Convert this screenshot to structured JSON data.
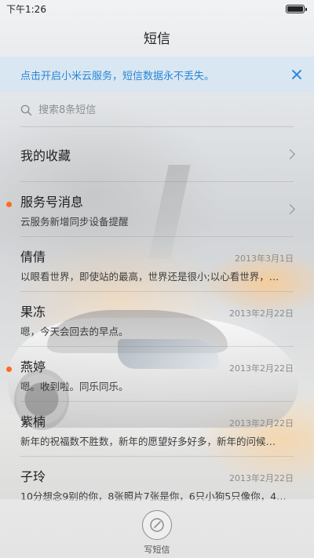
{
  "status_bar": {
    "time": "下午1:26",
    "battery_level": 1.0
  },
  "header": {
    "title": "短信"
  },
  "cloud_banner": {
    "text": "点击开启小米云服务，短信数据永不丢失。",
    "close_icon": "close-icon",
    "color": "#2a86d6"
  },
  "search": {
    "placeholder": "搜索8条短信",
    "icon": "search-icon"
  },
  "favorites": {
    "label": "我的收藏",
    "icon": "chevron-right-icon"
  },
  "service": {
    "label": "服务号消息",
    "preview": "云服务新增同步设备提醒",
    "unread": true,
    "icon": "chevron-right-icon"
  },
  "conversations": [
    {
      "name": "倩倩",
      "date": "2013年3月1日",
      "preview": "以眼看世界，即使站的最高，世界还是很小;以心看世界，…",
      "unread": false
    },
    {
      "name": "果冻",
      "date": "2013年2月22日",
      "preview": "嗯，今天会回去的早点。",
      "unread": false
    },
    {
      "name": "燕婷",
      "date": "2013年2月22日",
      "preview": "嗯。收到啦。同乐同乐。",
      "unread": true
    },
    {
      "name": "紫楠",
      "date": "2013年2月22日",
      "preview": "新年的祝福数不胜数，新年的愿望好多好多，新年的问候…",
      "unread": false
    },
    {
      "name": "子玲",
      "date": "2013年2月22日",
      "preview": "10分想念9别的你，8张照片7张是你，6只小狗5只像你，4…",
      "unread": false
    }
  ],
  "compose": {
    "label": "写短信",
    "icon": "compose-icon"
  },
  "colors": {
    "unread_dot": "#ff6a1f",
    "title_text": "#222222"
  }
}
